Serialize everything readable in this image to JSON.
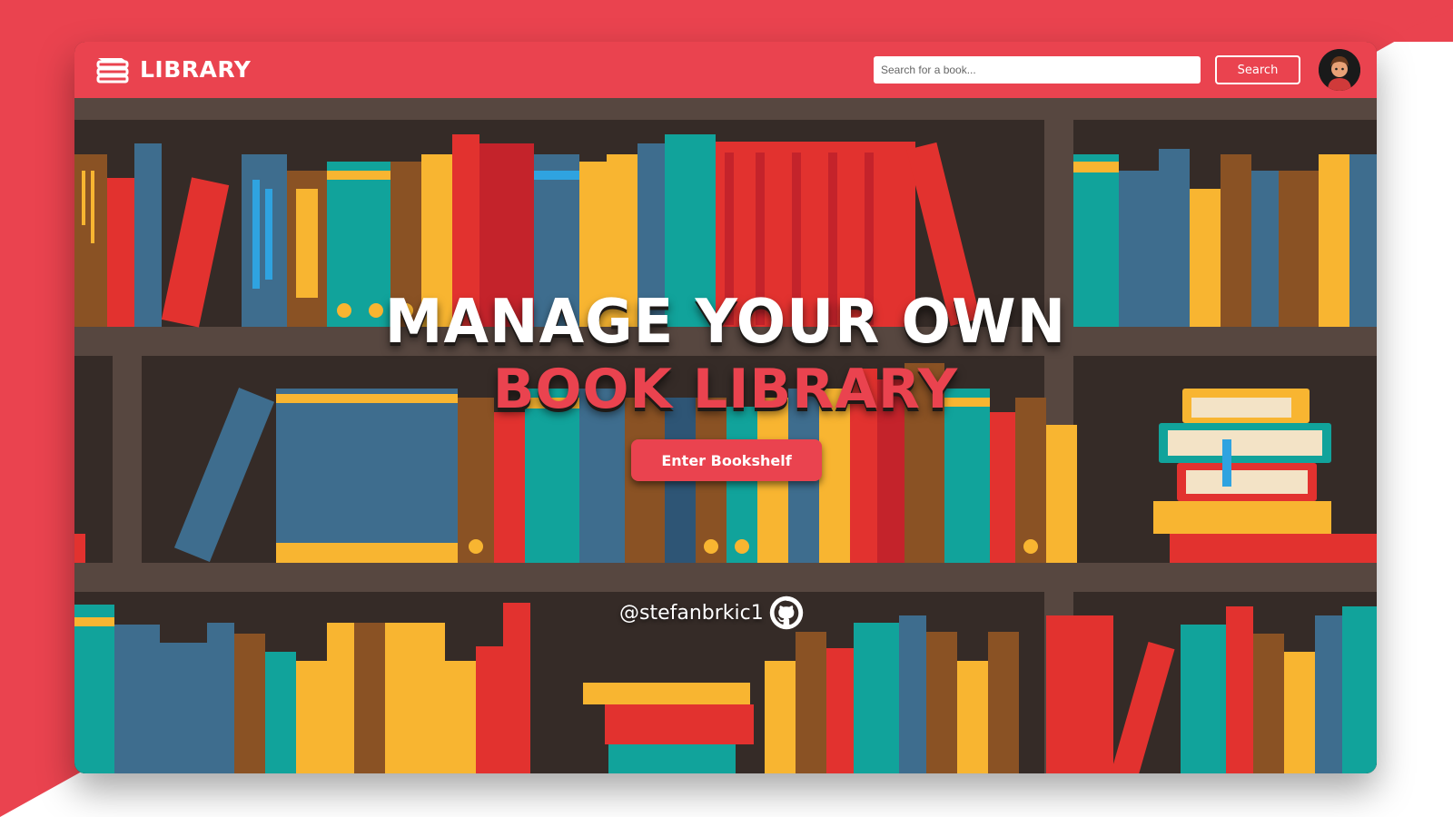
{
  "brand": {
    "name": "LIBRARY",
    "logo_icon": "books-stack-icon"
  },
  "search": {
    "placeholder": "Search for a book...",
    "value": "",
    "button_label": "Search"
  },
  "user": {
    "avatar_icon": "user-avatar-icon"
  },
  "hero": {
    "line1": "MANAGE YOUR OWN",
    "line2": "BOOK LIBRARY",
    "cta_label": "Enter Bookshelf"
  },
  "footer": {
    "github_handle": "@stefanbrkic1",
    "github_icon": "github-icon"
  },
  "colors": {
    "accent": "#ea434f",
    "shelf": "#574740",
    "shelf_back": "#352b27",
    "teal": "#11a39b",
    "blue": "#3e6d8e",
    "yellow": "#f8b531",
    "brown": "#8a5224",
    "red": "#e2322f"
  }
}
